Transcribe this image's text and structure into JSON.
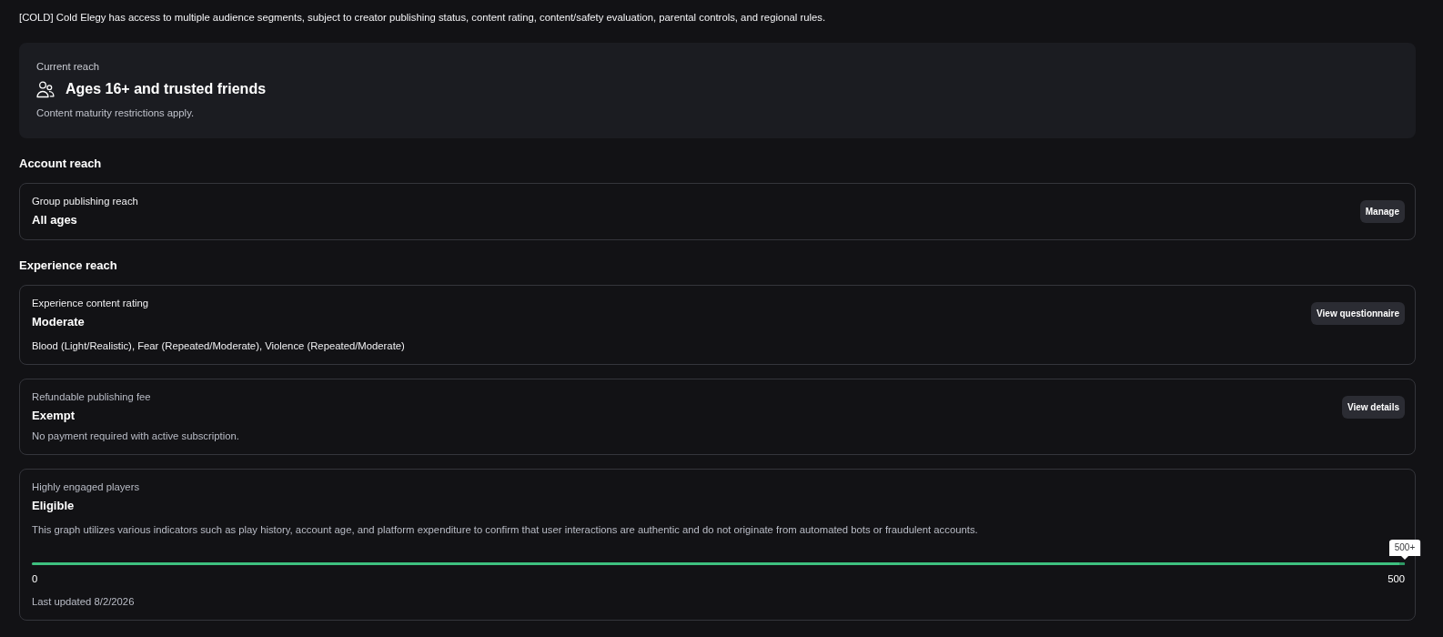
{
  "notice": "[COLD] Cold Elegy has access to multiple audience segments, subject to creator publishing status, content rating, content/safety evaluation, parental controls, and regional rules.",
  "current_reach": {
    "label": "Current reach",
    "title": "Ages 16+ and trusted friends",
    "note": "Content maturity restrictions apply."
  },
  "sections": [
    {
      "heading": "Account reach",
      "cards": [
        {
          "kind": "plain",
          "label": "Group publishing reach",
          "value": "All ages",
          "button": "Manage"
        }
      ]
    },
    {
      "heading": "Experience reach",
      "cards": [
        {
          "kind": "plain",
          "label": "Experience content rating",
          "value": "Moderate",
          "description": "Blood (Light/Realistic), Fear (Repeated/Moderate), Violence (Repeated/Moderate)",
          "button": "View questionnaire"
        },
        {
          "kind": "muted",
          "label": "Refundable publishing fee",
          "value": "Exempt",
          "description": "No payment required with active subscription.",
          "button": "View details"
        },
        {
          "kind": "meter",
          "label": "Highly engaged players",
          "value": "Eligible",
          "description": "This graph utilizes various indicators such as play history, account age, and platform expenditure to confirm that user interactions are authentic and do not originate from automated bots or fraudulent accounts.",
          "meter": {
            "level": 1,
            "tooltip": "500+",
            "min_label": "0",
            "max_label": "500"
          },
          "footnote": "Last updated 8/2/2026"
        }
      ]
    }
  ]
}
